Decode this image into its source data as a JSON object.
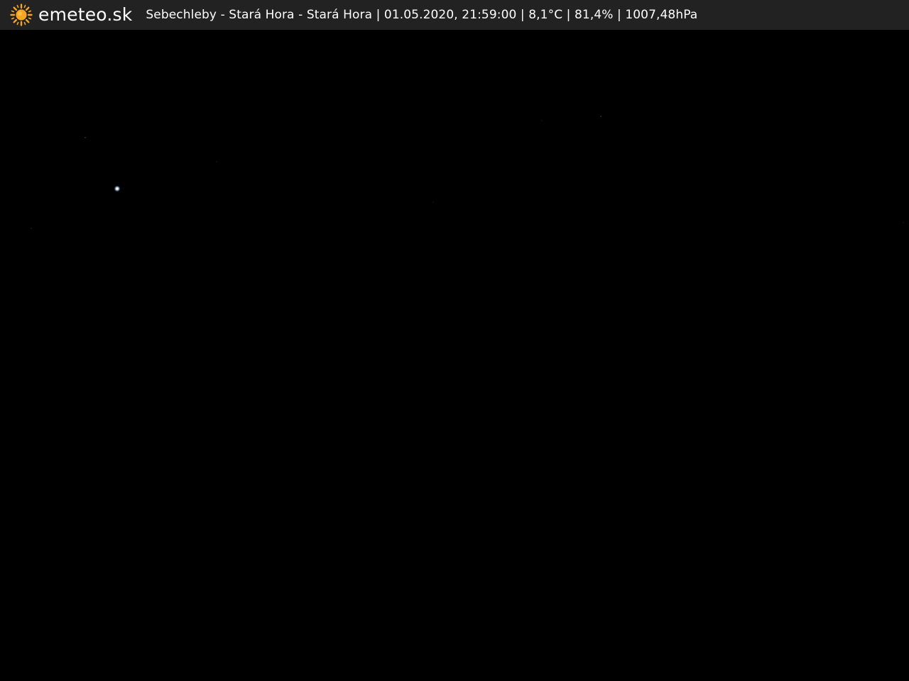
{
  "header": {
    "logo_text": "emeteo.sk",
    "logo_icon": "sun-icon",
    "caption": "Sebechleby - Stará Hora - Stará Hora | 01.05.2020, 21:59:00 | 8,1°C | 81,4% | 1007,48hPa"
  },
  "colors": {
    "bar_background": "#222222",
    "sun": "#f5a623",
    "sky": "#000000",
    "star": "#e8f4ff"
  }
}
